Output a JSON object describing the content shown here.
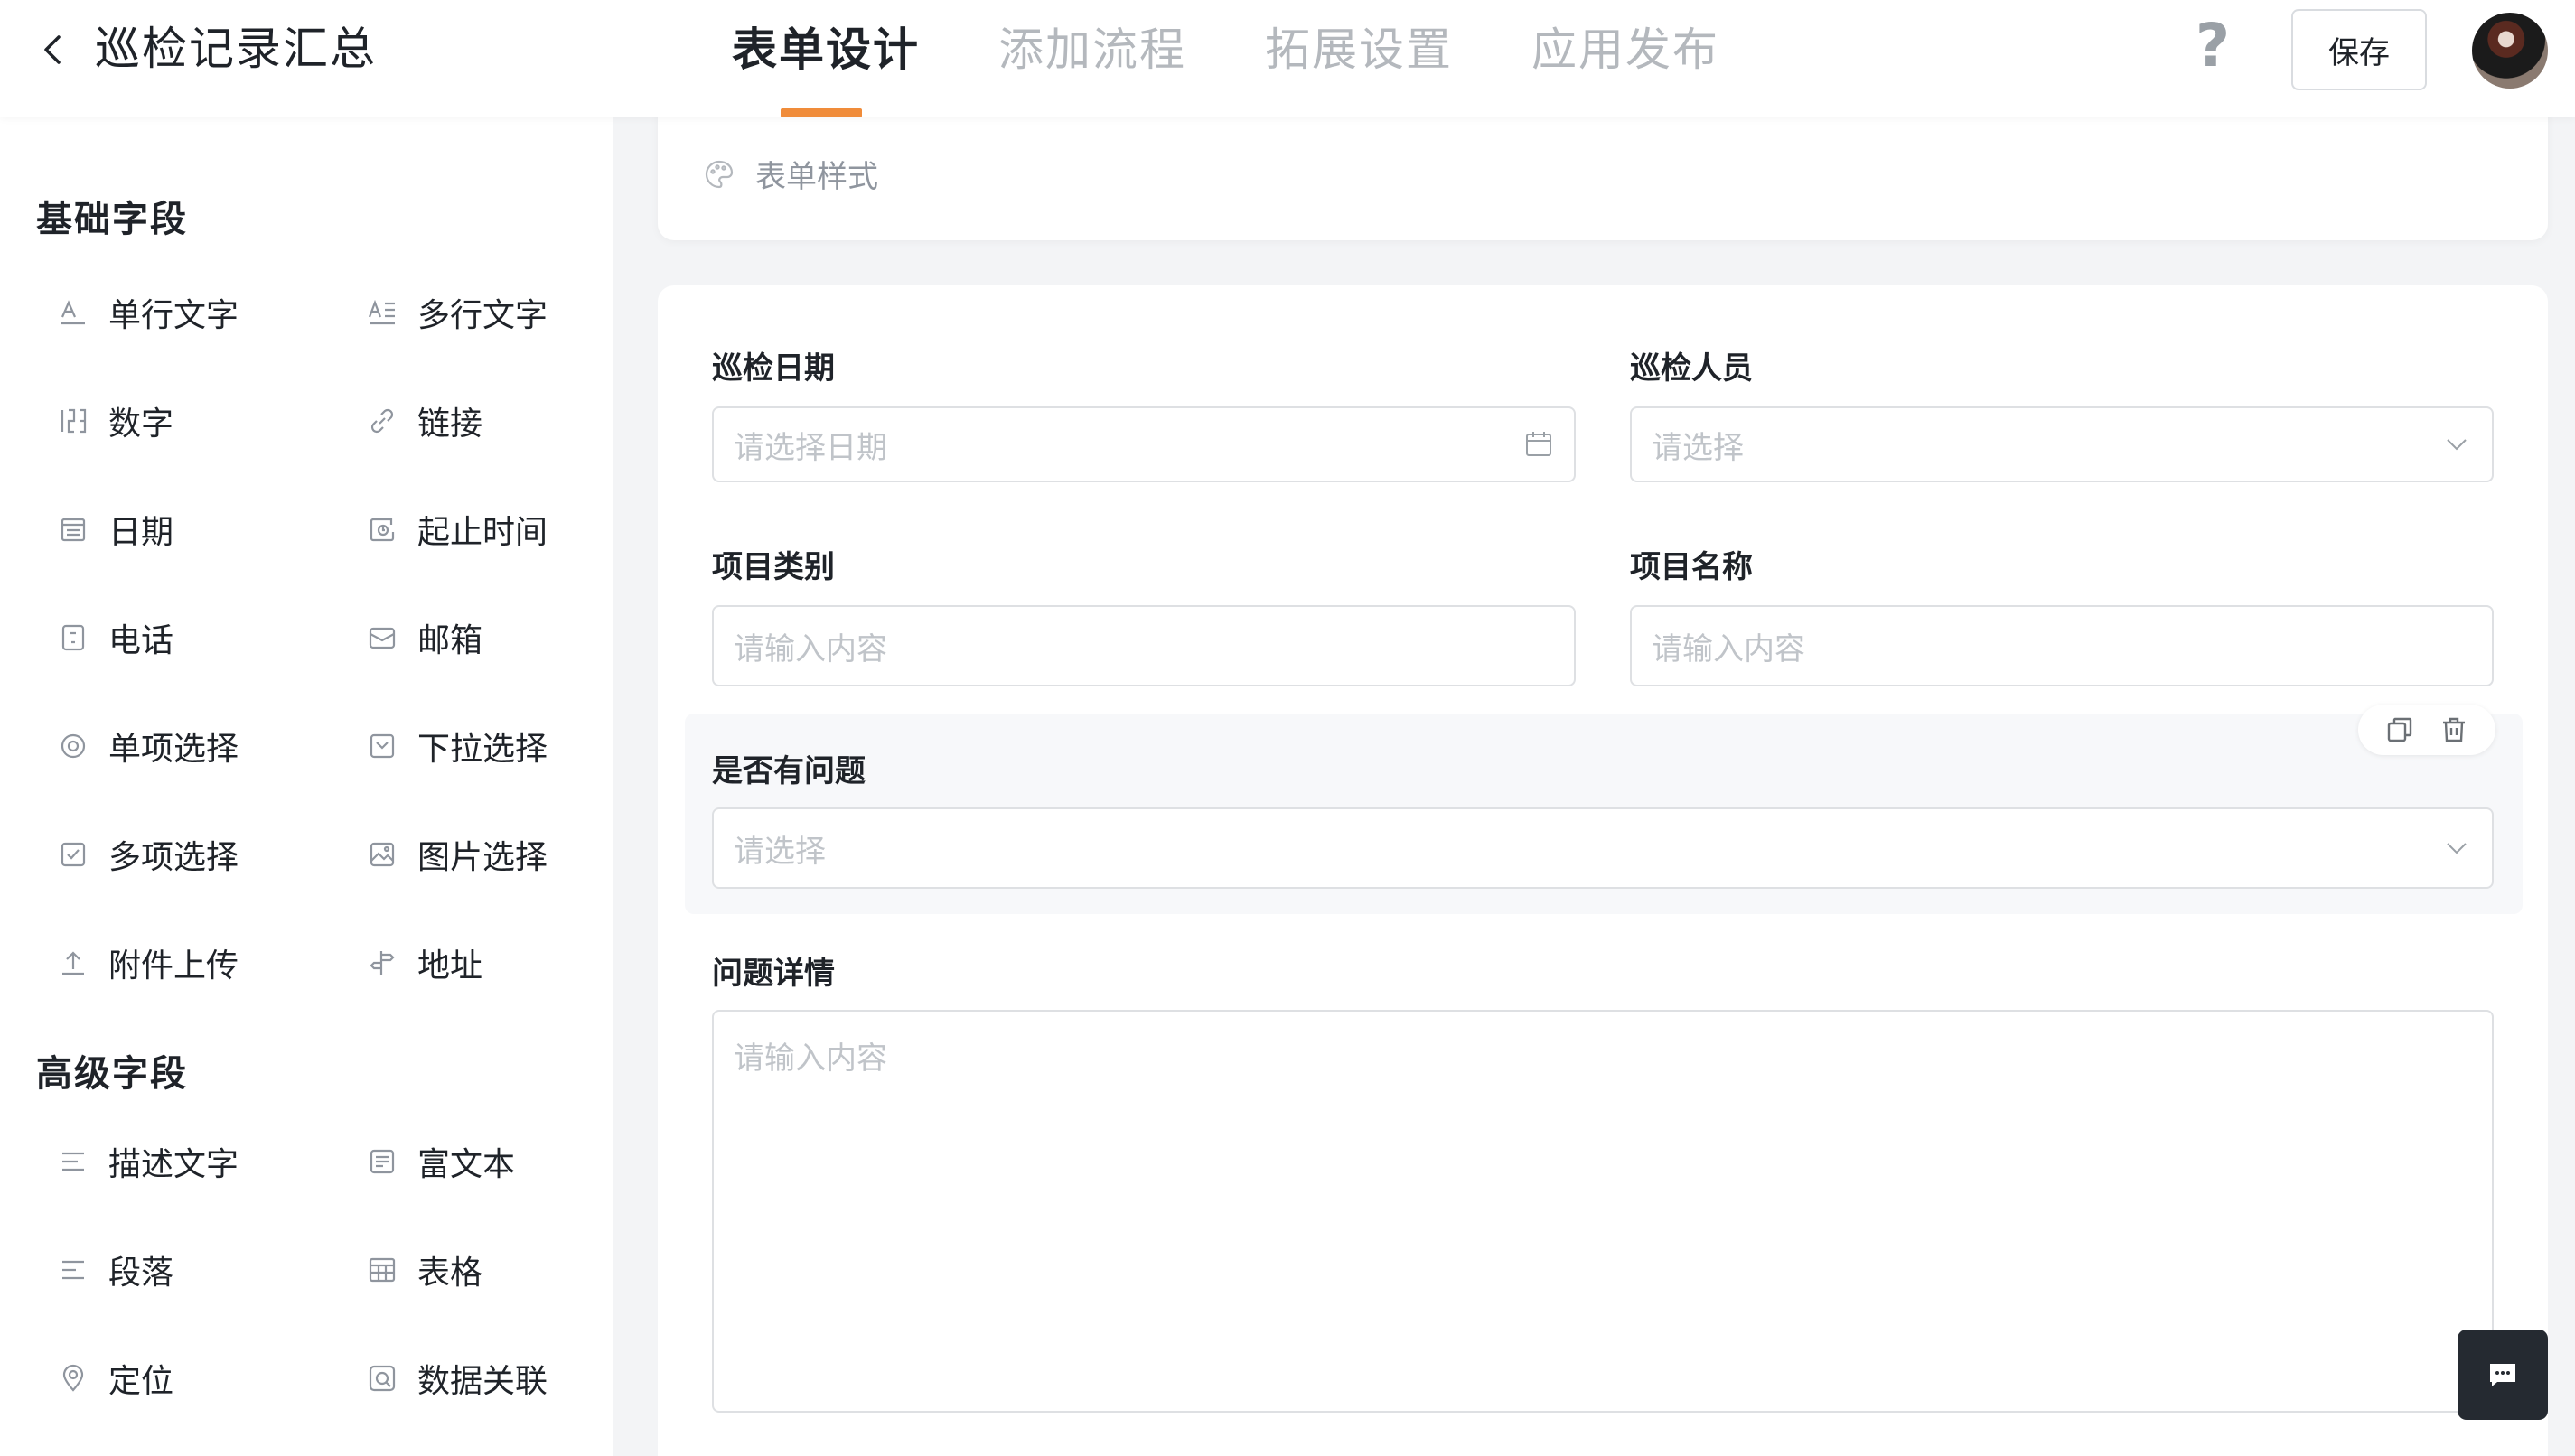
{
  "header": {
    "title": "巡检记录汇总",
    "tabs": [
      {
        "label": "表单设计",
        "active": true
      },
      {
        "label": "添加流程",
        "active": false
      },
      {
        "label": "拓展设置",
        "active": false
      },
      {
        "label": "应用发布",
        "active": false
      }
    ],
    "help_label": "?",
    "save_label": "保存"
  },
  "sidebar": {
    "basic_title": "基础字段",
    "basic_fields": [
      {
        "label": "单行文字",
        "icon": "single-line-text-icon"
      },
      {
        "label": "多行文字",
        "icon": "multi-line-text-icon"
      },
      {
        "label": "数字",
        "icon": "number-icon"
      },
      {
        "label": "链接",
        "icon": "link-icon"
      },
      {
        "label": "日期",
        "icon": "calendar-icon"
      },
      {
        "label": "起止时间",
        "icon": "time-range-icon"
      },
      {
        "label": "电话",
        "icon": "phone-icon"
      },
      {
        "label": "邮箱",
        "icon": "mail-icon"
      },
      {
        "label": "单项选择",
        "icon": "radio-icon"
      },
      {
        "label": "下拉选择",
        "icon": "dropdown-icon"
      },
      {
        "label": "多项选择",
        "icon": "checkbox-icon"
      },
      {
        "label": "图片选择",
        "icon": "image-icon"
      },
      {
        "label": "附件上传",
        "icon": "upload-icon"
      },
      {
        "label": "地址",
        "icon": "signpost-icon"
      }
    ],
    "advanced_title": "高级字段",
    "advanced_fields": [
      {
        "label": "描述文字",
        "icon": "description-icon"
      },
      {
        "label": "富文本",
        "icon": "rich-text-icon"
      },
      {
        "label": "段落",
        "icon": "paragraph-icon"
      },
      {
        "label": "表格",
        "icon": "table-icon"
      },
      {
        "label": "定位",
        "icon": "location-icon"
      },
      {
        "label": "数据关联",
        "icon": "data-link-icon"
      }
    ]
  },
  "form": {
    "style_label": "表单样式",
    "fields": {
      "date": {
        "label": "巡检日期",
        "placeholder": "请选择日期"
      },
      "inspector": {
        "label": "巡检人员",
        "placeholder": "请选择"
      },
      "category": {
        "label": "项目类别",
        "placeholder": "请输入内容"
      },
      "name": {
        "label": "项目名称",
        "placeholder": "请输入内容"
      },
      "has_issue": {
        "label": "是否有问题",
        "placeholder": "请选择"
      },
      "issue_detail": {
        "label": "问题详情",
        "placeholder": "请输入内容"
      }
    }
  },
  "colors": {
    "accent": "#f08c3a",
    "chat_button": "#252a31"
  }
}
